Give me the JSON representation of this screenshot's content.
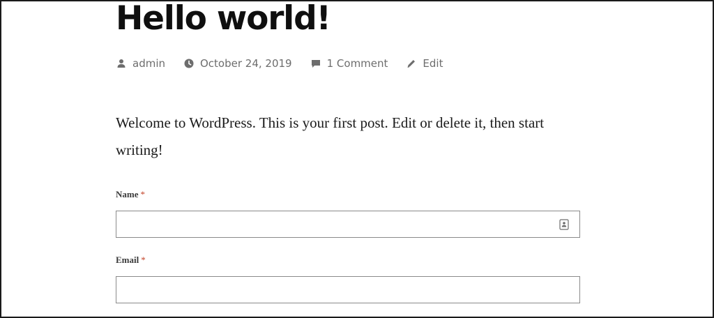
{
  "post": {
    "title": "Hello world!",
    "content": "Welcome to WordPress. This is your first post. Edit or delete it, then start writing!"
  },
  "meta": {
    "author": "admin",
    "date": "October 24, 2019",
    "comments": "1 Comment",
    "edit": "Edit",
    "icons": [
      "person-icon",
      "clock-icon",
      "comment-icon",
      "pencil-icon"
    ]
  },
  "form": {
    "name_label": "Name",
    "email_label": "Email",
    "required_mark": "*",
    "name_value": "",
    "email_value": ""
  },
  "colors": {
    "title": "#0f0f0f",
    "meta": "#6d6d6d",
    "required": "#c4452b",
    "input_border": "#8a8a8a"
  }
}
